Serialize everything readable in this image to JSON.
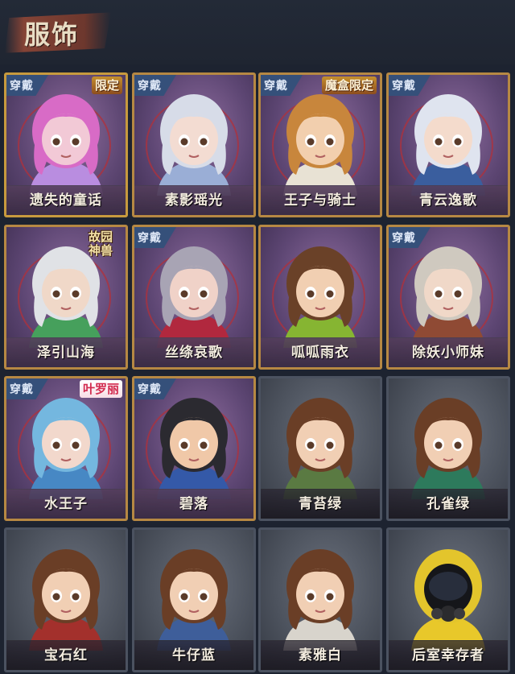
{
  "header": {
    "title": "服饰"
  },
  "cards": [
    {
      "name": "遗失的童话",
      "frame": "gold",
      "worn": true,
      "worn_label": "穿戴",
      "badge": "限定",
      "badge_style": "gold",
      "hair": "#d86bc6",
      "skin": "#f2c9d6",
      "cloth": "#b98de0"
    },
    {
      "name": "素影瑶光",
      "frame": "purple",
      "worn": true,
      "worn_label": "穿戴",
      "badge": "",
      "badge_style": "",
      "hair": "#d7dce8",
      "skin": "#f3dcd2",
      "cloth": "#9aaed6"
    },
    {
      "name": "王子与骑士",
      "frame": "purple",
      "worn": true,
      "worn_label": "穿戴",
      "badge": "魔盒限定",
      "badge_style": "gold",
      "hair": "#c8863c",
      "skin": "#f2cfae",
      "cloth": "#e8e2d4"
    },
    {
      "name": "青云逸歌",
      "frame": "purple",
      "worn": true,
      "worn_label": "穿戴",
      "badge": "",
      "badge_style": "",
      "hair": "#dfe4ef",
      "skin": "#f4dbcc",
      "cloth": "#3a5e9e"
    },
    {
      "name": "泽引山海",
      "frame": "purple",
      "worn": false,
      "worn_label": "",
      "badge": "故园神兽",
      "badge_style": "ink",
      "hair": "#e0e2e6",
      "skin": "#f0d8c8",
      "cloth": "#46a05c"
    },
    {
      "name": "丝绦哀歌",
      "frame": "purple",
      "worn": true,
      "worn_label": "穿戴",
      "badge": "",
      "badge_style": "",
      "hair": "#a8a4b4",
      "skin": "#f0d2c8",
      "cloth": "#b1283e"
    },
    {
      "name": "呱呱雨衣",
      "frame": "purple",
      "worn": false,
      "worn_label": "",
      "badge": "",
      "badge_style": "",
      "hair": "#6a4128",
      "skin": "#f1cfb2",
      "cloth": "#86b532"
    },
    {
      "name": "除妖小师妹",
      "frame": "purple",
      "worn": true,
      "worn_label": "穿戴",
      "badge": "",
      "badge_style": "",
      "hair": "#cfc9bf",
      "skin": "#f0d8c8",
      "cloth": "#8f4a34"
    },
    {
      "name": "水王子",
      "frame": "purple",
      "worn": true,
      "worn_label": "穿戴",
      "badge": "叶罗丽",
      "badge_style": "pink",
      "hair": "#74b7df",
      "skin": "#f2d8cc",
      "cloth": "#4788c4"
    },
    {
      "name": "碧落",
      "frame": "purple",
      "worn": true,
      "worn_label": "穿戴",
      "badge": "",
      "badge_style": "",
      "hair": "#2b2a30",
      "skin": "#f0c8a8",
      "cloth": "#3459a8"
    },
    {
      "name": "青苔绿",
      "frame": "gray",
      "worn": false,
      "worn_label": "",
      "badge": "",
      "badge_style": "",
      "hair": "#6a3e26",
      "skin": "#f1cfb4",
      "cloth": "#5a7a42"
    },
    {
      "name": "孔雀绿",
      "frame": "gray",
      "worn": false,
      "worn_label": "",
      "badge": "",
      "badge_style": "",
      "hair": "#6a3e26",
      "skin": "#f1cfb4",
      "cloth": "#2d7a5c"
    },
    {
      "name": "宝石红",
      "frame": "gray",
      "worn": false,
      "worn_label": "",
      "badge": "",
      "badge_style": "",
      "hair": "#6a3e26",
      "skin": "#f1cfb4",
      "cloth": "#a3302c"
    },
    {
      "name": "牛仔蓝",
      "frame": "gray",
      "worn": false,
      "worn_label": "",
      "badge": "",
      "badge_style": "",
      "hair": "#6a3e26",
      "skin": "#f1cfb4",
      "cloth": "#3e5e9a"
    },
    {
      "name": "素雅白",
      "frame": "gray",
      "worn": false,
      "worn_label": "",
      "badge": "",
      "badge_style": "",
      "hair": "#6a3e26",
      "skin": "#f1cfb4",
      "cloth": "#d8d4cc"
    },
    {
      "name": "后室幸存者",
      "frame": "gray",
      "worn": false,
      "worn_label": "",
      "badge": "",
      "badge_style": "",
      "hair": "#e3c52c",
      "skin": "#1d1e22",
      "cloth": "#e8c82a"
    }
  ]
}
